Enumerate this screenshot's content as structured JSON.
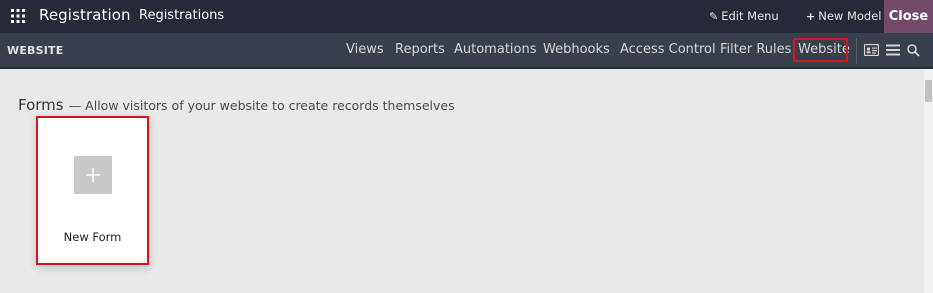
{
  "topbar": {
    "app_title": "Registration",
    "menu_item": "Registrations",
    "edit_menu": "Edit Menu",
    "new_model": "New Model",
    "close": "Close"
  },
  "subbar": {
    "section": "WEBSITE",
    "tabs": [
      "Views",
      "Reports",
      "Automations",
      "Webhooks",
      "Access Control",
      "Filter Rules",
      "Website"
    ],
    "active_tab": "Website"
  },
  "content": {
    "forms_title": "Forms",
    "forms_description": "— Allow visitors of your website to create records themselves",
    "new_form_label": "New Form"
  },
  "colors": {
    "topbar_bg": "#262a36",
    "subbar_bg": "#3a3f4c",
    "close_bg": "#714b67",
    "highlight": "#d8141c",
    "content_bg": "#e9e9e9"
  },
  "icons": [
    "apps-grid-icon",
    "pencil-icon",
    "plus-icon",
    "form-view-icon",
    "list-view-icon",
    "search-icon",
    "plus-box-icon"
  ]
}
